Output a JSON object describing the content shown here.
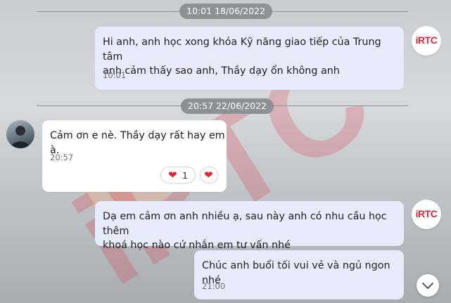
{
  "time_dividers": [
    "10:01 18/06/2022",
    "20:57 22/06/2022"
  ],
  "sender_avatar_text": "iRTC",
  "watermark_text": "iRTC",
  "messages": [
    {
      "text_lines": [
        "Hi anh, anh học xong khóa Kỹ năng giao tiếp của Trung tâm",
        "anh cảm thấy sao anh, Thầy dạy ổn không anh"
      ],
      "time": "10:01",
      "direction": "out"
    },
    {
      "text_lines": [
        "Cảm ơn e nè. Thầy dạy rất hay em à."
      ],
      "time": "20:57",
      "direction": "in",
      "reaction_count": "1"
    },
    {
      "text_lines": [
        "Dạ em cảm ơn anh nhiều ạ, sau này anh có nhu cầu học thêm",
        "khoá học nào cứ nhắn em tư vấn nhé"
      ],
      "direction": "out"
    },
    {
      "text_lines": [
        "Chúc anh buổi tối vui vẻ và ngủ ngon nhé"
      ],
      "time": "21:00",
      "direction": "out"
    }
  ],
  "colors": {
    "accent_red": "#e0263a",
    "outgoing_bubble": "#e6ecfb",
    "incoming_bubble": "#ffffff",
    "time_pill": "#8d9196"
  },
  "icons": {
    "reaction": "heart-icon",
    "scroll": "chevron-down-icon"
  }
}
